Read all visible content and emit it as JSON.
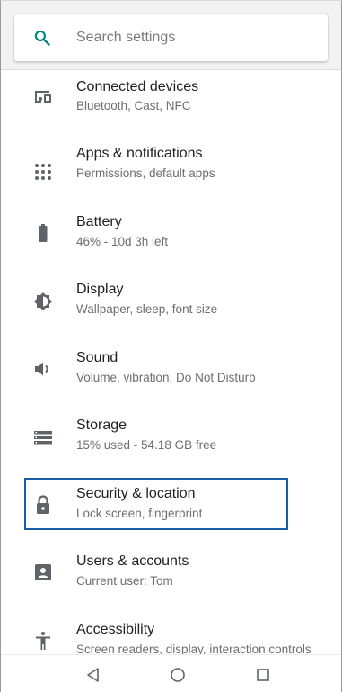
{
  "search": {
    "placeholder": "Search settings",
    "accent_color": "#00897b"
  },
  "settings_items": [
    {
      "title": "Connected devices",
      "subtitle": "Bluetooth, Cast, NFC",
      "icon": "connected-devices-icon"
    },
    {
      "title": "Apps & notifications",
      "subtitle": "Permissions, default apps",
      "icon": "apps-grid-icon"
    },
    {
      "title": "Battery",
      "subtitle": "46% - 10d 3h left",
      "icon": "battery-icon"
    },
    {
      "title": "Display",
      "subtitle": "Wallpaper, sleep, font size",
      "icon": "brightness-icon"
    },
    {
      "title": "Sound",
      "subtitle": "Volume, vibration, Do Not Disturb",
      "icon": "speaker-icon"
    },
    {
      "title": "Storage",
      "subtitle": "15% used - 54.18 GB free",
      "icon": "storage-icon"
    },
    {
      "title": "Security & location",
      "subtitle": "Lock screen, fingerprint",
      "icon": "lock-icon"
    },
    {
      "title": "Users & accounts",
      "subtitle": "Current user: Tom",
      "icon": "account-box-icon"
    },
    {
      "title": "Accessibility",
      "subtitle": "Screen readers, display, interaction controls",
      "icon": "accessibility-icon"
    }
  ],
  "highlight": {
    "target": "Security & location",
    "color": "#1a5aa0"
  },
  "navigation": {
    "buttons": [
      "back-icon",
      "home-icon",
      "recents-icon"
    ]
  },
  "colors": {
    "icon": "#5f6368",
    "title": "#212121",
    "subtitle": "#6e6e6e"
  }
}
